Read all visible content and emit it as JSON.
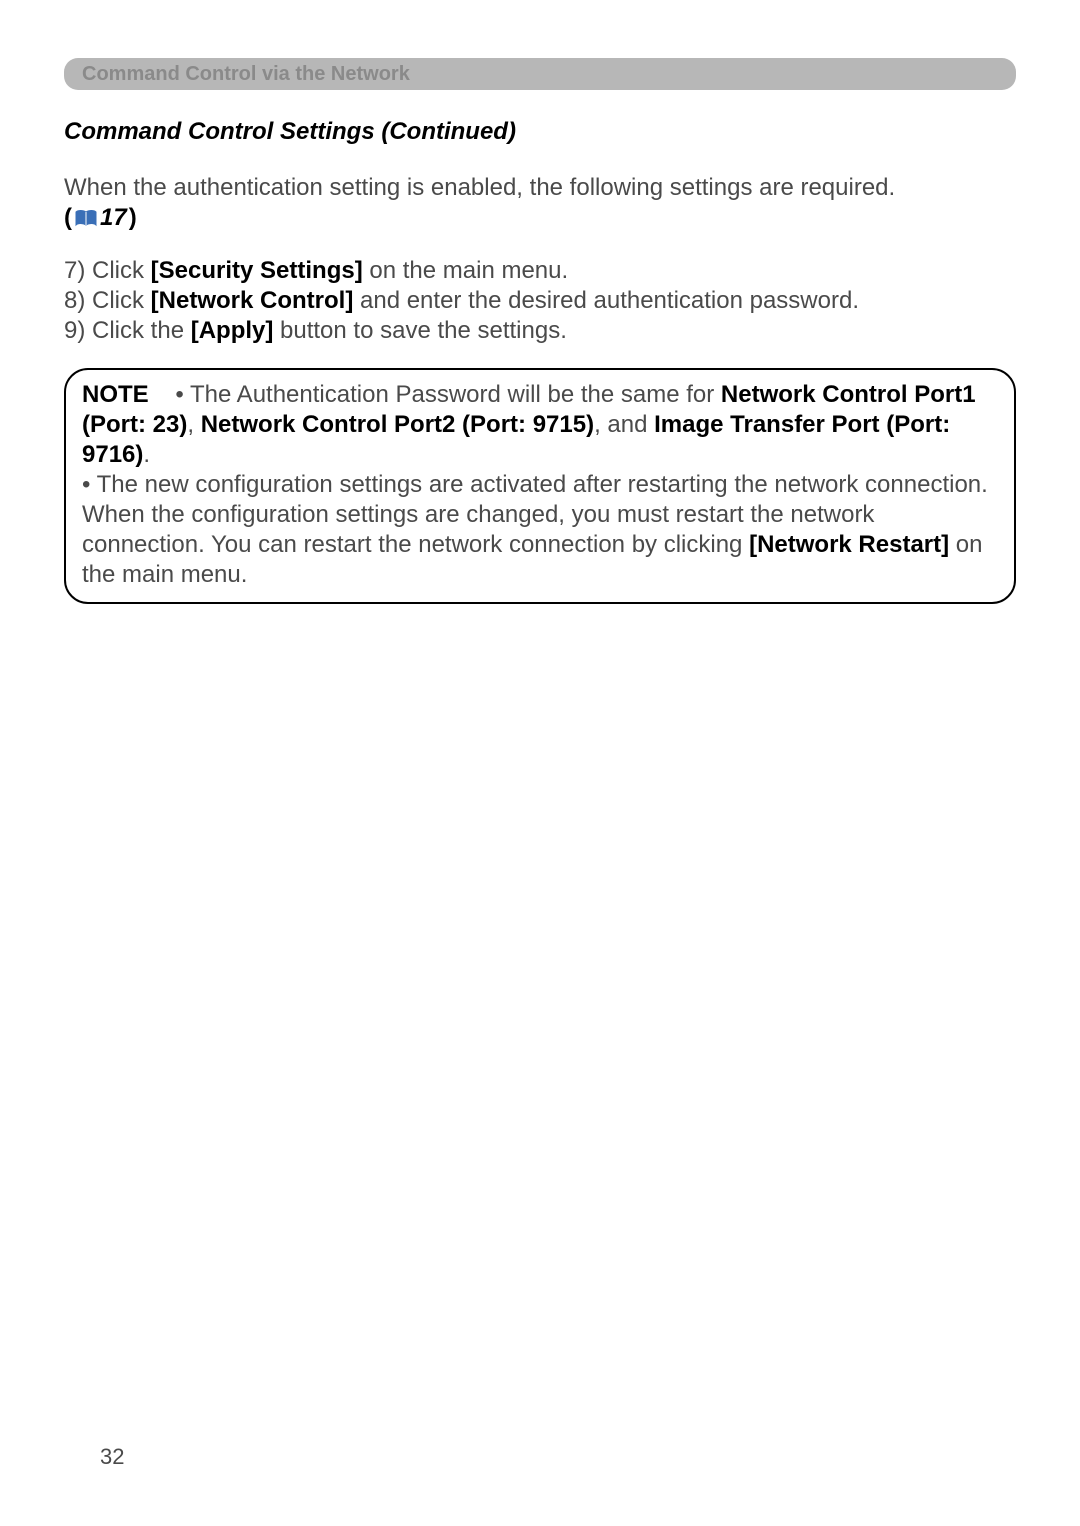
{
  "banner": {
    "title": "Command Control via the Network"
  },
  "subheading": "Command Control Settings (Continued)",
  "intro": "When the authentication setting is enabled, the following settings are required.",
  "xref": {
    "open": "(",
    "page": "17",
    "close": ")"
  },
  "steps": {
    "s7_pre": "7) Click ",
    "s7_bold": "[Security Settings]",
    "s7_post": " on the main menu.",
    "s8_pre": "8) Click ",
    "s8_bold": "[Network Control]",
    "s8_post": " and enter the desired authentication password.",
    "s9_pre": "9) Click the ",
    "s9_bold": "[Apply]",
    "s9_post": " button to save the settings."
  },
  "note": {
    "label": "NOTE",
    "p1_a": "• The Authentication Password will be the same for ",
    "p1_b1": "Network Control Port1 (Port: 23)",
    "p1_c": ", ",
    "p1_b2": "Network Control Port2 (Port: 9715)",
    "p1_d": ", and ",
    "p1_b3": "Image Transfer Port (Port: 9716)",
    "p1_e": ".",
    "p2_a": "• The new configuration settings are activated after restarting the network connection. When the configuration settings are changed, you must restart the network connection. You can restart the network connection by clicking ",
    "p2_b": "[Network Restart]",
    "p2_c": " on the main menu."
  },
  "pageNumber": "32"
}
